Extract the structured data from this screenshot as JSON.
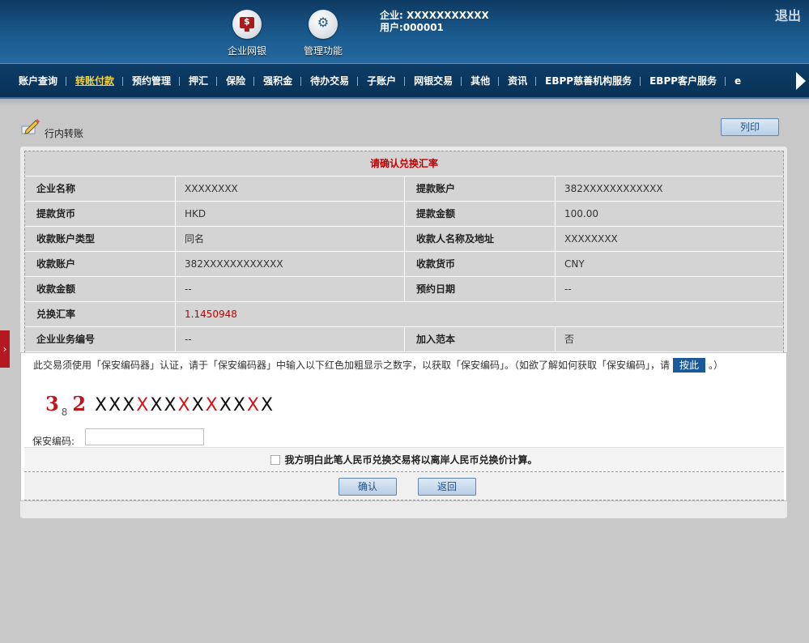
{
  "header": {
    "buttons": [
      {
        "label": "企业网银",
        "icon": "monitor-icon"
      },
      {
        "label": "管理功能",
        "icon": "gears-icon"
      }
    ],
    "company_line": "企业: XXXXXXXXXXX",
    "user_line": "用户:000001",
    "logout": "退出"
  },
  "nav": {
    "items": [
      "账户查询",
      "转账付款",
      "预约管理",
      "押汇",
      "保险",
      "强积金",
      "待办交易",
      "子账户",
      "网银交易",
      "其他",
      "资讯",
      "EBPP慈善机构服务",
      "EBPP客户服务",
      "e"
    ],
    "active_index": 1
  },
  "page": {
    "title": "行内转账",
    "print_label": "列印",
    "side_tab": "›"
  },
  "form": {
    "header": "请确认兑换汇率",
    "rows": [
      [
        {
          "label": "企业名称",
          "value": "XXXXXXXX"
        },
        {
          "label": "提款账户",
          "value": "382XXXXXXXXXXXX"
        }
      ],
      [
        {
          "label": "提款货币",
          "value": "HKD"
        },
        {
          "label": "提款金额",
          "value": "100.00"
        }
      ],
      [
        {
          "label": "收款账户类型",
          "value": "同名"
        },
        {
          "label": "收款人名称及地址",
          "value": "XXXXXXXX"
        }
      ],
      [
        {
          "label": "收款账户",
          "value": "382XXXXXXXXXXXX"
        },
        {
          "label": "收款货币",
          "value": "CNY"
        }
      ],
      [
        {
          "label": "收款金额",
          "value": "--"
        },
        {
          "label": "预约日期",
          "value": "--"
        }
      ],
      [
        {
          "label": "兑换汇率",
          "value": "1.1450948"
        }
      ],
      [
        {
          "label": "企业业务编号",
          "value": "--"
        },
        {
          "label": "加入范本",
          "value": "否"
        }
      ]
    ]
  },
  "verify": {
    "desc_before": "此交易须使用「保安编码器」认证，请于「保安编码器」中输入以下红色加粗显示之数字，以获取「保安编码」。（如欲了解如何获取「保安编码」，请",
    "here_button": "按此",
    "desc_after": "。）",
    "code_prefix_a": "3",
    "code_prefix_sub": "8",
    "code_prefix_b": "2",
    "code_chars": [
      {
        "c": "X",
        "red": false
      },
      {
        "c": "X",
        "red": false
      },
      {
        "c": "X",
        "red": false
      },
      {
        "c": "X",
        "red": true
      },
      {
        "c": "X",
        "red": false
      },
      {
        "c": "X",
        "red": false
      },
      {
        "c": "X",
        "red": true
      },
      {
        "c": "X",
        "red": false
      },
      {
        "c": "X",
        "red": true
      },
      {
        "c": "X",
        "red": false
      },
      {
        "c": "X",
        "red": false
      },
      {
        "c": "X",
        "red": true
      },
      {
        "c": "X",
        "red": false
      }
    ],
    "pin_label": "保安编码:",
    "pin_value": "",
    "agree_text": "我方明白此笔人民币兑换交易将以离岸人民币兑换价计算。",
    "confirm": "确认",
    "back": "返回"
  },
  "colors": {
    "header_dark": "#0e3a62",
    "nav_active": "#f5d23c",
    "highlight_red": "#c00000",
    "button_blue": "#1a5a9a"
  }
}
